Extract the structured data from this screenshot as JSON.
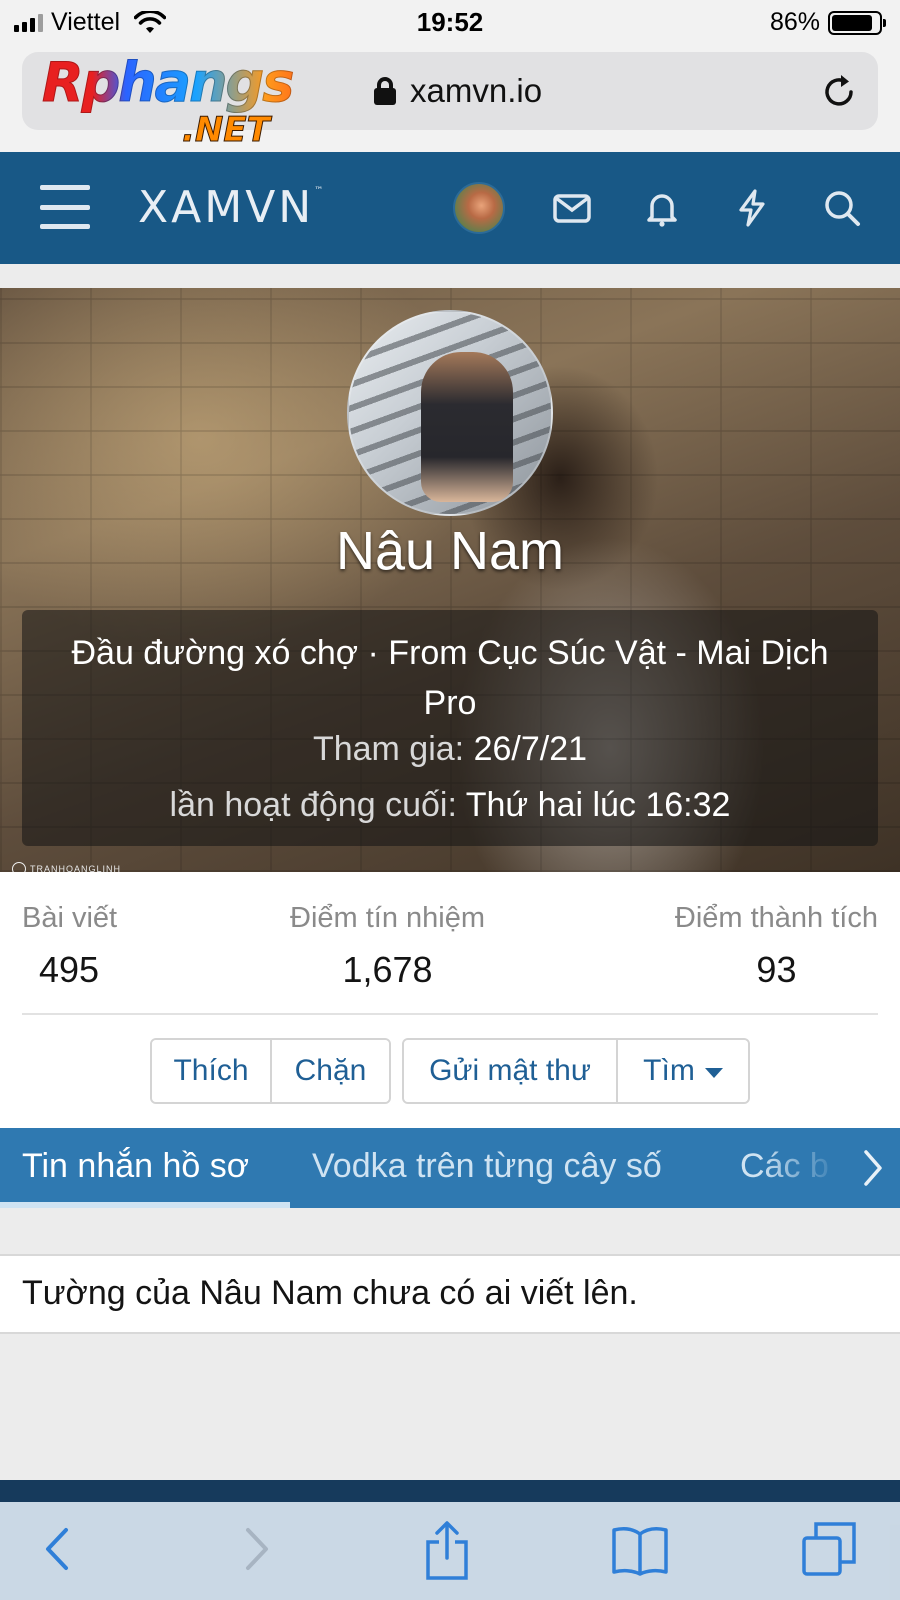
{
  "status_bar": {
    "carrier": "Viettel",
    "time": "19:52",
    "battery_percent": "86%",
    "battery_level": 0.86
  },
  "browser": {
    "url": "xamvn.io"
  },
  "watermark": {
    "main": "Rphangs",
    "sub": ".NET"
  },
  "site": {
    "logo": "XAMVN",
    "trademark": "™"
  },
  "profile": {
    "name": "Nâu Nam",
    "title": "Đầu đường xó chợ · From Cục Súc Vật - Mai Dịch Pro",
    "joined_label": "Tham gia:",
    "joined_value": "26/7/21",
    "last_seen_label": "lần hoạt động cuối:",
    "last_seen_value": "Thứ hai lúc 16:32",
    "photo_credit": "TRANHOANGLINH"
  },
  "stats": [
    {
      "label": "Bài viết",
      "value": "495"
    },
    {
      "label": "Điểm tín nhiệm",
      "value": "1,678"
    },
    {
      "label": "Điểm thành tích",
      "value": "93"
    }
  ],
  "actions": {
    "like": "Thích",
    "block": "Chặn",
    "message": "Gửi mật thư",
    "find": "Tìm"
  },
  "tabs": [
    {
      "label": "Tin nhắn hồ sơ",
      "active": true
    },
    {
      "label": "Vodka trên từng cây số",
      "active": false
    },
    {
      "label": "Các b",
      "active": false
    }
  ],
  "wall": {
    "empty_message": "Tường của Nâu Nam chưa có ai viết lên."
  },
  "colors": {
    "header": "#185886",
    "tabs": "#2f79b1",
    "link": "#1f5f95"
  },
  "icons": [
    "signal-icon",
    "wifi-icon",
    "battery-icon",
    "lock-icon",
    "reload-icon",
    "menu-icon",
    "mail-icon",
    "bell-icon",
    "bolt-icon",
    "search-icon",
    "chevron-right-icon",
    "back-icon",
    "forward-icon",
    "share-icon",
    "bookmarks-icon",
    "tabs-icon"
  ]
}
